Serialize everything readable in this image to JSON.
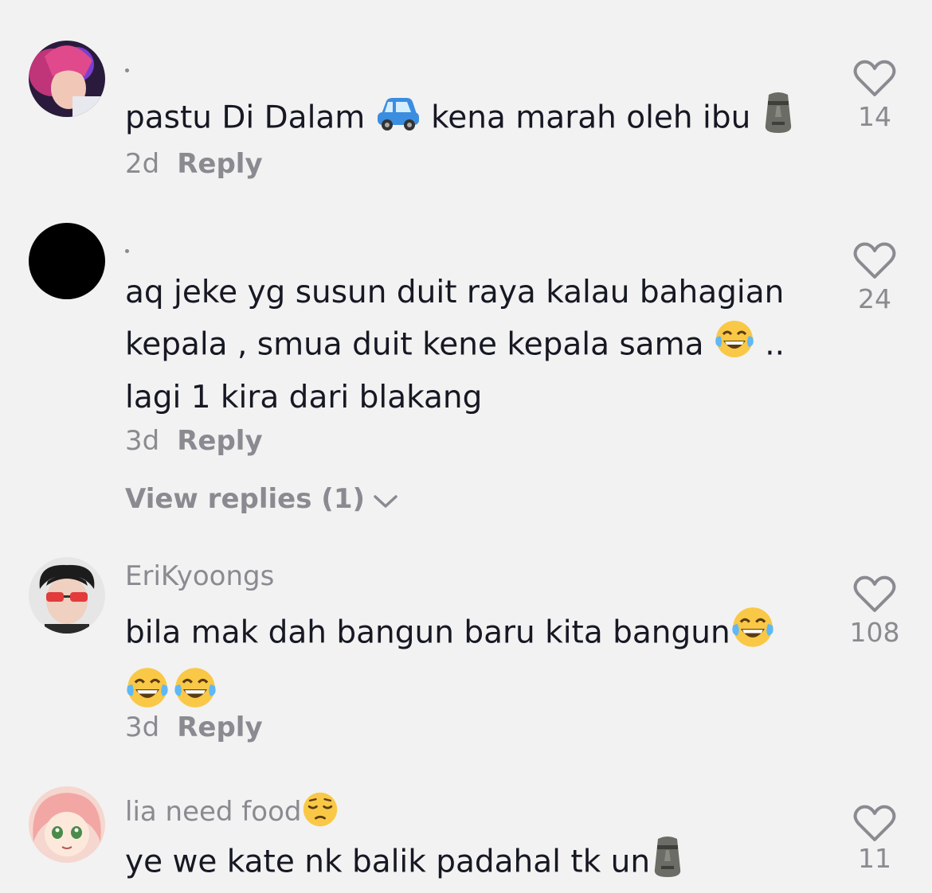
{
  "comments": [
    {
      "username": ".",
      "text_parts": [
        "pastu Di Dalam ",
        " kena marah oleh ibu "
      ],
      "emojis": [
        "car-emoji",
        "moai-emoji"
      ],
      "time": "2d",
      "reply_label": "Reply",
      "likes": "14"
    },
    {
      "username": ".",
      "text_line1": "aq jeke yg susun duit raya kalau bahagian",
      "text_line2a": "kepala , smua duit kene kepala sama ",
      "text_line2b": " ..",
      "text_line3": "lagi 1 kira dari blakang",
      "emojis": [
        "tears-of-joy-emoji"
      ],
      "time": "3d",
      "reply_label": "Reply",
      "view_replies": "View replies (1)",
      "likes": "24"
    },
    {
      "username": "EriKyoongs",
      "text": "bila mak dah bangun baru kita bangun",
      "emojis": [
        "tears-of-joy-emoji",
        "tears-of-joy-emoji",
        "tears-of-joy-emoji"
      ],
      "time": "3d",
      "reply_label": "Reply",
      "likes": "108"
    },
    {
      "username": "lia need food",
      "username_emoji": "pensive-emoji",
      "text": "ye we kate nk balik padahal tk un",
      "emojis": [
        "moai-emoji"
      ],
      "likes": "11"
    }
  ],
  "colors": {
    "background": "#f2f2f2",
    "text": "#161823",
    "secondary": "#8a8b91"
  }
}
